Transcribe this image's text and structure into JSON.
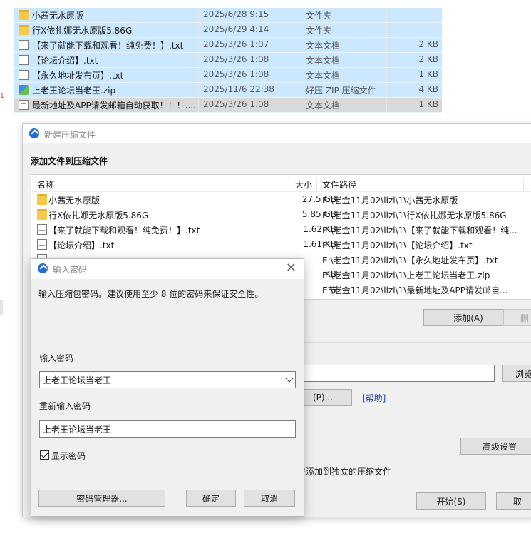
{
  "explorer": {
    "rows": [
      {
        "name": "小茜无水原版",
        "date": "2025/6/28 9:15",
        "type": "文件夹",
        "size": "",
        "icon": "folder-icon"
      },
      {
        "name": "行X依扎娜无水原版5.86G",
        "date": "2025/6/29 4:14",
        "type": "文件夹",
        "size": "",
        "icon": "folder-icon"
      },
      {
        "name": "【来了就能下载和观看！纯免费！】.txt",
        "date": "2025/3/26 1:07",
        "type": "文本文档",
        "size": "2 KB",
        "icon": "text-file-icon"
      },
      {
        "name": "【论坛介绍】.txt",
        "date": "2025/3/26 1:08",
        "type": "文本文档",
        "size": "2 KB",
        "icon": "text-file-icon"
      },
      {
        "name": "【永久地址发布页】.txt",
        "date": "2025/3/26 1:08",
        "type": "文本文档",
        "size": "1 KB",
        "icon": "text-file-icon"
      },
      {
        "name": "上老王论坛当老王.zip",
        "date": "2025/11/6 22:38",
        "type": "好压 ZIP 压缩文件",
        "size": "4 KB",
        "icon": "zip-file-icon"
      },
      {
        "name": "最新地址及APP请发邮箱自动获取！！！....",
        "date": "2025/3/26 1:08",
        "type": "文本文档",
        "size": "1 KB",
        "icon": "text-file-icon"
      }
    ],
    "left_mark": "1"
  },
  "main_dialog": {
    "title": "新建压缩文件",
    "section_title": "添加文件到压缩文件",
    "columns": {
      "name": "名称",
      "size": "大小",
      "path": "文件路径"
    },
    "files": [
      {
        "name": "小茜无水原版",
        "size": "27.5 GB",
        "path": "E:\\老金11月02\\lizi\\1\\小茜无水原版",
        "icon": "folder-icon"
      },
      {
        "name": "行X依扎娜无水原版5.86G",
        "size": "5.85 GB",
        "path": "E:\\老金11月02\\lizi\\1\\行X依扎娜无水原版5.86G",
        "icon": "folder-icon"
      },
      {
        "name": "【来了就能下载和观看！纯免费！】.txt",
        "size": "1.62 KB",
        "path": "E:\\老金11月02\\lizi\\1\\【来了就能下载和观看！纯...",
        "icon": "text-file-icon"
      },
      {
        "name": "【论坛介绍】.txt",
        "size": "1.61 KB",
        "path": "E:\\老金11月02\\lizi\\1\\【论坛介绍】.txt",
        "icon": "text-file-icon"
      },
      {
        "name": "",
        "size": "",
        "path": "E:\\老金11月02\\lizi\\1\\【永久地址发布页】.txt",
        "icon": "text-file-icon"
      },
      {
        "name": "",
        "size": "KB",
        "path": "E:\\老金11月02\\lizi\\1\\上老王论坛当老王.zip",
        "icon": "zip-file-icon"
      },
      {
        "name": "",
        "size": "节",
        "path": "E:\\老金11月02\\lizi\\1\\最新地址及APP请发邮自...",
        "icon": "text-file-icon"
      }
    ],
    "add_button": "添加(A)",
    "delete_button": "删",
    "browse_button": "浏览",
    "set_password_button": "(P)...",
    "help_link": "[帮助]",
    "advanced_button": "高级设置",
    "separate_text": "夹添加到独立的压缩文件",
    "start_button": "开始(S)",
    "cancel_button_partial": "取"
  },
  "password_dialog": {
    "title": "输入密码",
    "description": "输入压缩包密码。建议使用至少 8 位的密码来保证安全性。",
    "label_enter": "输入密码",
    "password_value": "上老王论坛当老王",
    "label_reenter": "重新输入密码",
    "reenter_value": "上老王论坛当老王",
    "show_password_label": "显示密码",
    "show_password_checked": true,
    "manager_button": "密码管理器...",
    "ok_button": "确定",
    "cancel_button": "取消"
  }
}
